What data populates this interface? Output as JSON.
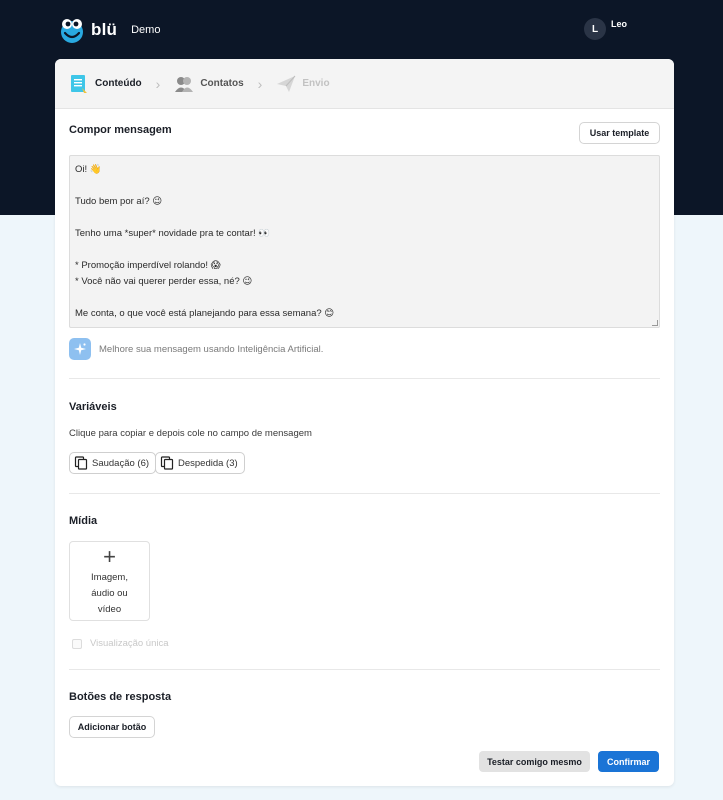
{
  "header": {
    "brand": "blü",
    "environment": "Demo",
    "user_initial": "L",
    "user_name": "Leo",
    "logo_icon": "blu-mascot-logo"
  },
  "stepper": {
    "steps": [
      {
        "label": "Conteúdo",
        "icon": "document-icon",
        "state": "active"
      },
      {
        "label": "Contatos",
        "icon": "contacts-icon",
        "state": "done"
      },
      {
        "label": "Envio",
        "icon": "paper-plane-icon",
        "state": "disabled"
      }
    ]
  },
  "compose": {
    "title": "Compor mensagem",
    "template_button": "Usar template",
    "message_lines": [
      "Oi! 👋",
      "",
      "Tudo bem por aí? 😉",
      "",
      "Tenho uma *super* novidade pra te contar! 👀",
      "",
      "*  Promoção imperdível rolando! 😱",
      "*  Você não vai querer perder essa, né? 😉",
      "",
      "Me conta, o que você está planejando para essa semana? 😊"
    ],
    "ai_hint": "Melhore sua mensagem usando Inteligência Artificial."
  },
  "variables": {
    "title": "Variáveis",
    "hint": "Clique para copiar e depois cole no campo de mensagem",
    "chips": [
      "Saudação (6)",
      "Despedida (3)"
    ]
  },
  "media": {
    "title": "Mídia",
    "add_plus": "+",
    "add_label": "Imagem, áudio ou vídeo",
    "single_view_label": "Visualização única"
  },
  "reply_buttons": {
    "title": "Botões de resposta",
    "add_button": "Adicionar botão"
  },
  "actions": {
    "test_button": "Testar comigo mesmo",
    "confirm_button": "Confirmar"
  },
  "colors": {
    "header_bg": "#0c1627",
    "accent": "#1a74d6",
    "ai_icon_bg": "#8ec0f0"
  }
}
